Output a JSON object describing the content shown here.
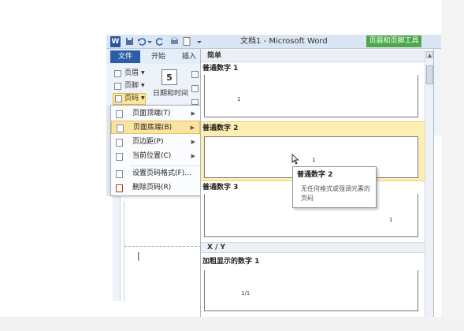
{
  "titlebar": {
    "app_icon": "W",
    "title": "文档1 - Microsoft Word",
    "context_tab": "页眉和页脚工具",
    "qat_icons": [
      "save-icon",
      "undo-icon",
      "redo-icon",
      "new-doc-icon",
      "dropdown-icon"
    ]
  },
  "ribbon": {
    "tabs": [
      "文件",
      "开始",
      "插入"
    ],
    "header_btn": "页眉",
    "footer_btn": "页脚",
    "pagenum_btn": "页码",
    "datetime_label": "日期和时间",
    "datetime_icon_text": "5"
  },
  "menu": {
    "items": [
      {
        "label": "页面顶端(T)",
        "icon": "page-top-icon",
        "arrow": "▶"
      },
      {
        "label": "页面底端(B)",
        "icon": "page-bottom-icon",
        "arrow": "▶"
      },
      {
        "label": "页边距(P)",
        "icon": "page-margin-icon",
        "arrow": "▶"
      },
      {
        "label": "当前位置(C)",
        "icon": "current-position-icon",
        "arrow": "▶"
      },
      {
        "label": "设置页码格式(F)...",
        "icon": "format-pagenum-icon",
        "arrow": ""
      },
      {
        "label": "删除页码(R)",
        "icon": "delete-pagenum-icon",
        "arrow": ""
      }
    ]
  },
  "gallery": {
    "header": "简单",
    "items": [
      {
        "label": "普通数字 1",
        "dot": "1"
      },
      {
        "label": "普通数字 2",
        "dot": "1"
      },
      {
        "label": "普通数字 3",
        "dot": "1"
      }
    ],
    "section2": "X / Y",
    "bold_item": {
      "label": "加粗显示的数字 1",
      "dot": "1/1"
    }
  },
  "tooltip": {
    "title": "普通数字 2",
    "desc": "无任何格式或强调元素的页码"
  },
  "document": {
    "cursor_char": "|"
  }
}
